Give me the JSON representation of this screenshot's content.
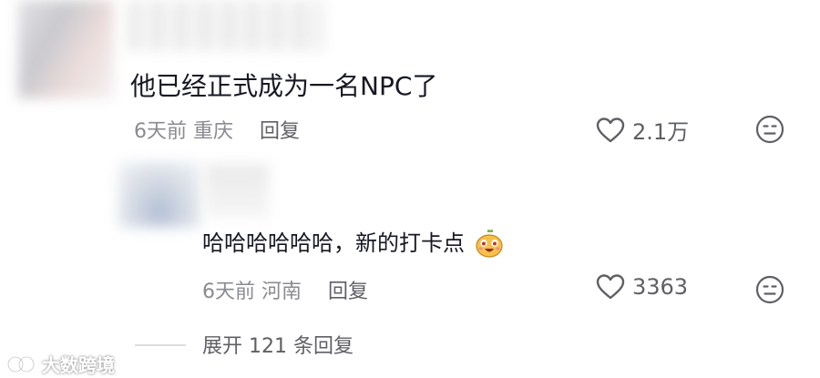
{
  "comment1": {
    "text": "他已经正式成为一名NPC了",
    "time": "6天前",
    "location": "重庆",
    "reply_label": "回复",
    "likes": "2.1万"
  },
  "comment2": {
    "text": "哈哈哈哈哈哈，新的打卡点",
    "time": "6天前",
    "location": "河南",
    "reply_label": "回复",
    "likes": "3363"
  },
  "expand_replies": "展开 121 条回复",
  "watermark": "大数跨境",
  "colors": {
    "text": "#161823",
    "meta": "#8a8b91",
    "action": "#5f6066"
  }
}
